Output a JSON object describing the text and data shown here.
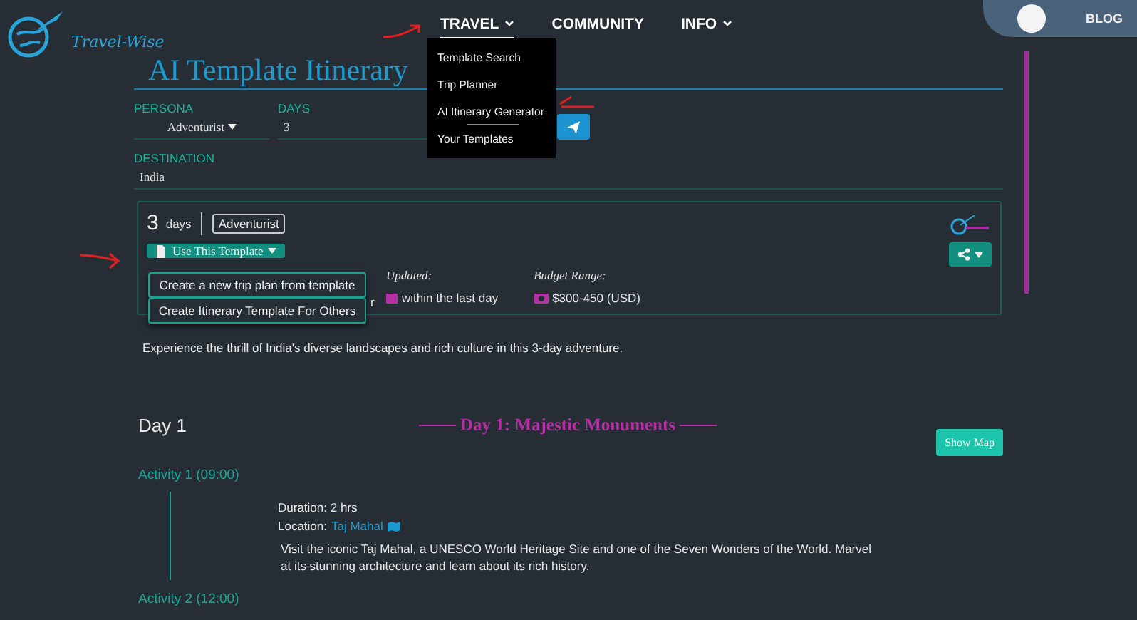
{
  "logo": {
    "text": "Travel-Wise"
  },
  "nav": [
    {
      "label": "TRAVEL",
      "has_menu": true,
      "selected": true
    },
    {
      "label": "COMMUNITY",
      "has_menu": false,
      "selected": false
    },
    {
      "label": "INFO",
      "has_menu": true,
      "selected": false
    }
  ],
  "travel_menu": [
    {
      "label": "Template Search",
      "selected": false
    },
    {
      "label": "Trip Planner",
      "selected": false
    },
    {
      "label": "AI Itinerary Generator",
      "selected": true
    },
    {
      "label": "Your Templates",
      "selected": false
    }
  ],
  "blog_tab": {
    "label": "BLOG"
  },
  "title": "AI Template Itinerary",
  "form": {
    "persona": {
      "label": "PERSONA",
      "value": "Adventurist"
    },
    "days": {
      "label": "DAYS",
      "value": "3"
    },
    "destination": {
      "label": "DESTINATION",
      "value": "India"
    }
  },
  "card": {
    "days_count": "3",
    "days_unit": "days",
    "persona_badge": "Adventurist",
    "use_button": "Use This Template",
    "template_menu": [
      "Create a new trip plan from template",
      "Create Itinerary Template For Others"
    ],
    "covered_text": "r",
    "updated": {
      "label": "Updated:",
      "value": "within the last day"
    },
    "budget": {
      "label": "Budget Range:",
      "value": "$300-450 (USD)"
    }
  },
  "description": "Experience the thrill of India's diverse landscapes and rich culture in this 3-day adventure.",
  "day": {
    "label": "Day 1",
    "heading": "Day 1: Majestic Monuments",
    "map_button": "Show Map"
  },
  "activities": [
    {
      "title": "Activity 1 (09:00)",
      "duration": "Duration: 2 hrs",
      "location_label": "Location:",
      "location": "Taj Mahal",
      "description": "Visit the iconic Taj Mahal, a UNESCO World Heritage Site and one of the Seven Wonders of the World. Marvel at its stunning architecture and learn about its rich history."
    },
    {
      "title": "Activity 2 (12:00)"
    }
  ]
}
